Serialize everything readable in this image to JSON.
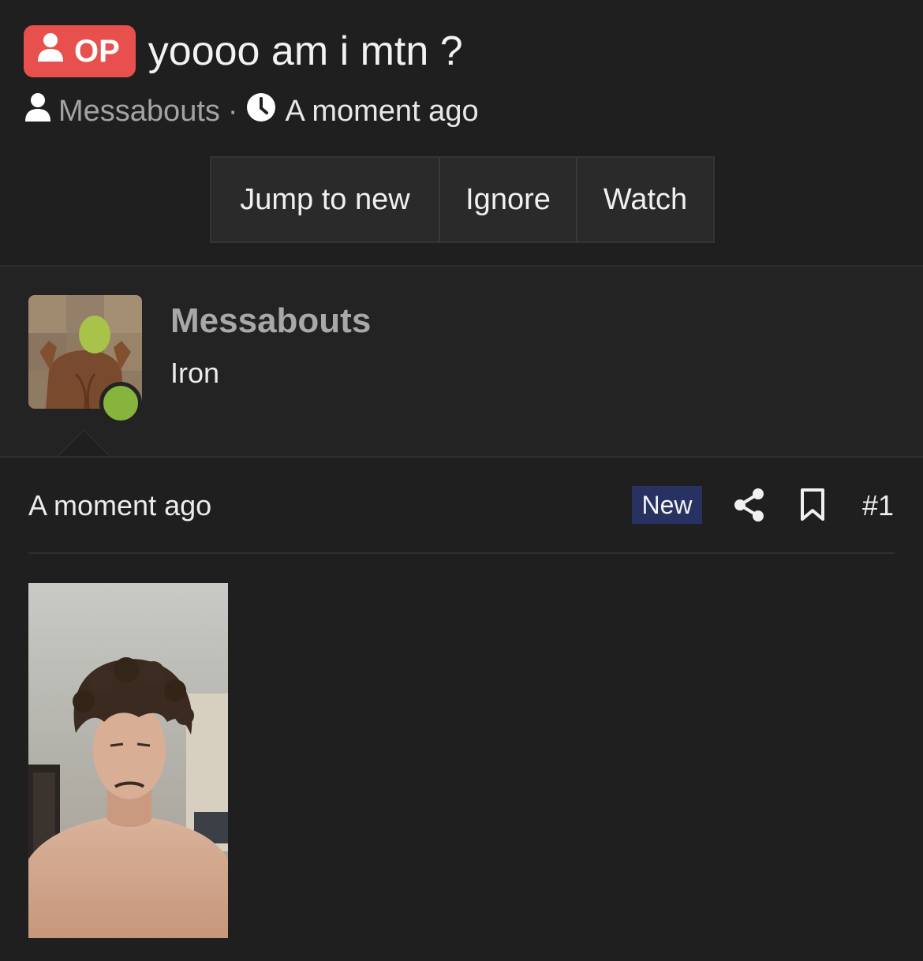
{
  "thread": {
    "op_badge": "OP",
    "title": "yoooo am i mtn ?",
    "author": "Messabouts",
    "separator": "·",
    "time": "A moment ago"
  },
  "actions": {
    "jump_label": "Jump to new",
    "ignore_label": "Ignore",
    "watch_label": "Watch"
  },
  "user": {
    "name": "Messabouts",
    "title": "Iron",
    "status": "online"
  },
  "post": {
    "time": "A moment ago",
    "new_badge": "New",
    "number": "#1",
    "icons": [
      "share-icon",
      "bookmark-icon"
    ]
  },
  "colors": {
    "background": "#1f1f20",
    "op_badge": "#e8504d",
    "new_badge": "#283262",
    "online": "#86b43c"
  }
}
